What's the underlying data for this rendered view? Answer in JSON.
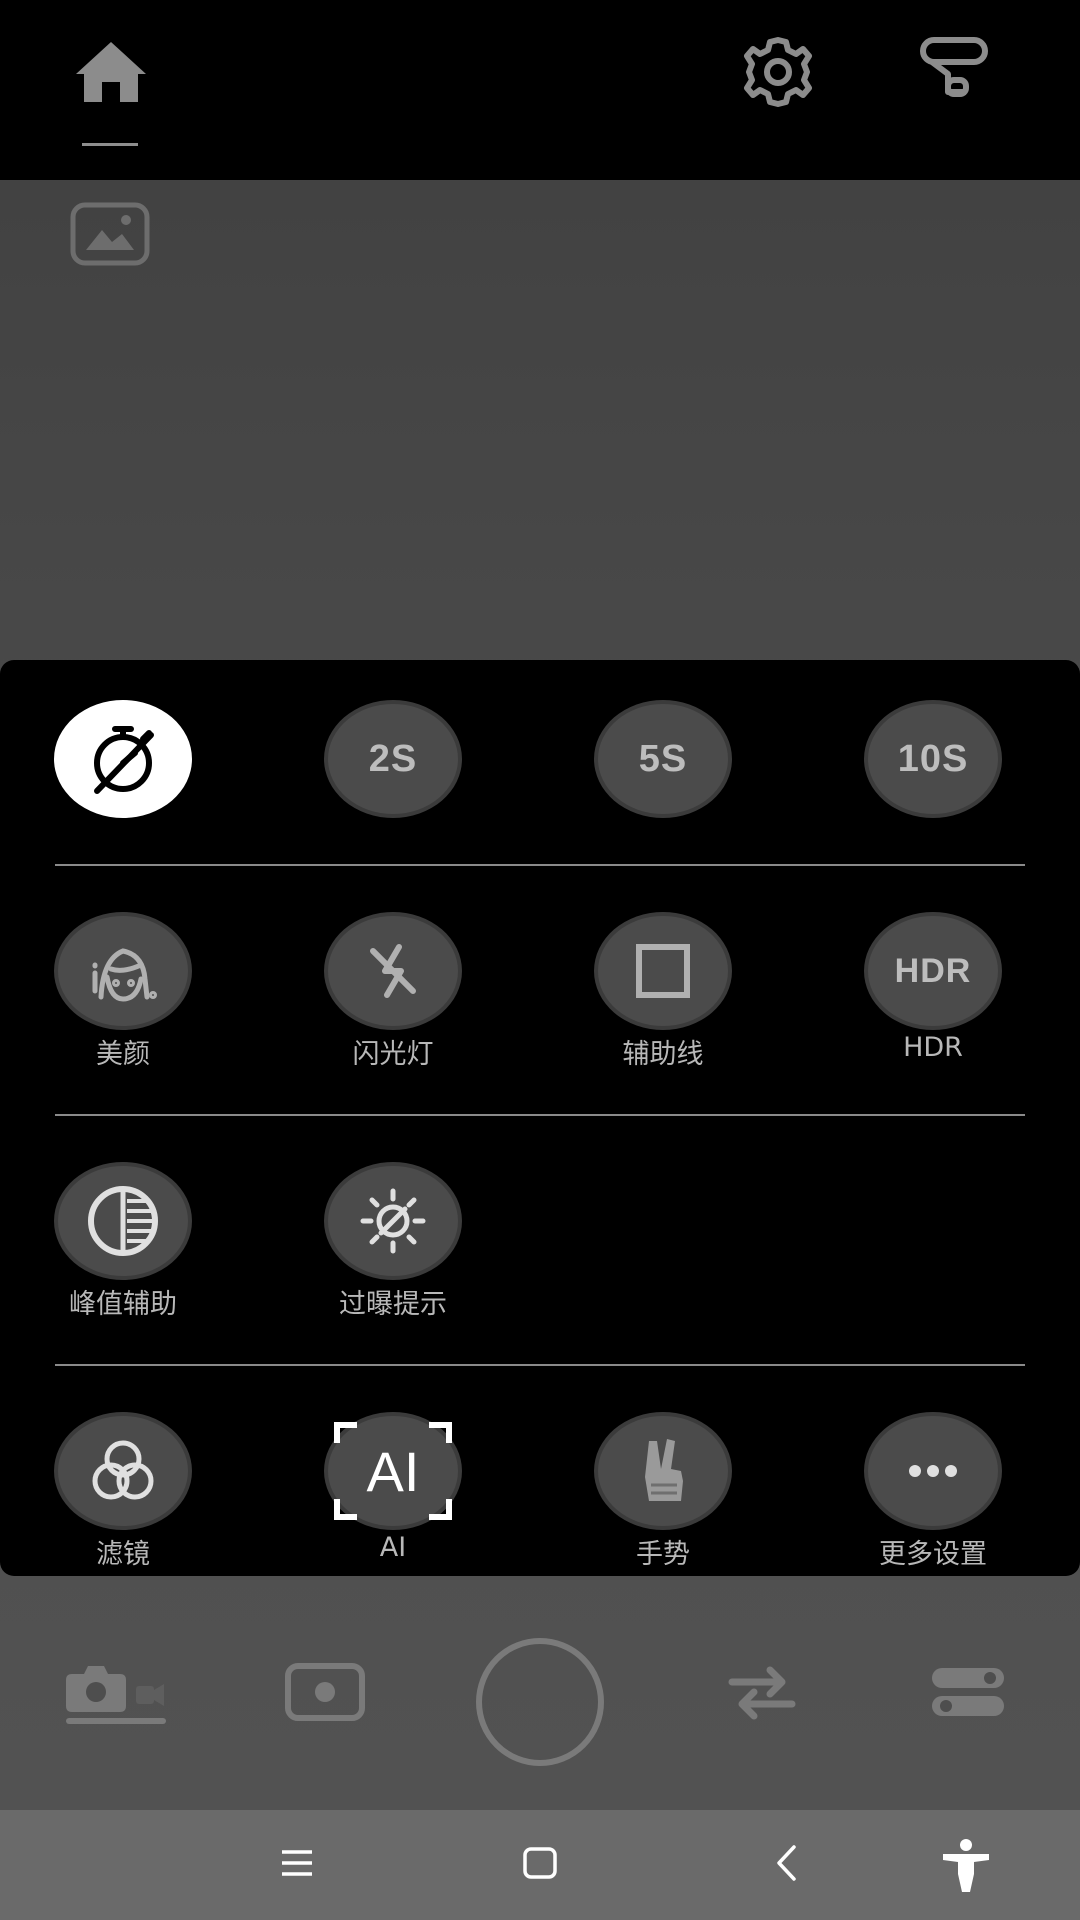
{
  "topbar": {
    "icons": [
      "home-icon",
      "settings-gear-icon",
      "gimbal-icon"
    ]
  },
  "preview": {
    "gallery_icon": "image-gallery-icon"
  },
  "panel": {
    "timer": {
      "options": [
        "2S",
        "5S",
        "10S"
      ],
      "off_icon": "timer-off-icon",
      "selected": "off"
    },
    "row2": [
      {
        "label": "美颜",
        "icon": "beauty-face-icon"
      },
      {
        "label": "闪光灯",
        "icon": "flash-off-icon"
      },
      {
        "label": "辅助线",
        "icon": "grid-square-icon"
      },
      {
        "label": "HDR",
        "icon_text": "HDR"
      }
    ],
    "row3": [
      {
        "label": "峰值辅助",
        "icon": "peaking-icon"
      },
      {
        "label": "过曝提示",
        "icon": "overexposure-icon"
      }
    ],
    "row4": [
      {
        "label": "滤镜",
        "icon": "filter-icon"
      },
      {
        "label": "AI",
        "icon_text": "AI"
      },
      {
        "label": "手势",
        "icon": "gesture-icon"
      },
      {
        "label": "更多设置",
        "icon": "more-icon"
      }
    ]
  },
  "bottom": {
    "icons": [
      "photo-video-mode-icon",
      "camera-mode-icon",
      "shutter-button",
      "switch-camera-icon",
      "toggle-settings-icon"
    ]
  },
  "navbar": {
    "icons": [
      "recent-apps-icon",
      "home-nav-icon",
      "back-icon",
      "accessibility-icon"
    ]
  },
  "colors": {
    "panel_bg": "#000000",
    "button_bg": "#4b4b4b",
    "active_bg": "#ffffff",
    "label_text": "#b8b8b8"
  }
}
